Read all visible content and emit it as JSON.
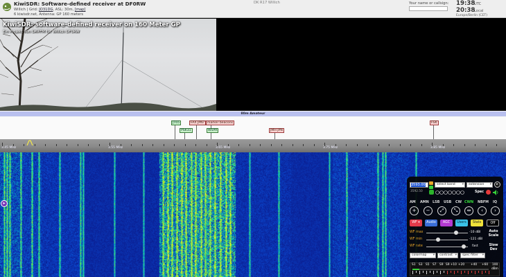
{
  "header": {
    "title": "KiwiSDR: Software-defined receiver at DF0RW",
    "subline_prefix": "Willich | Grid: ",
    "grid": "JO31DG",
    "subline_mid": ", ASL: 30m, ",
    "map_link": "[map]",
    "users_line": "6 kiwisdr.net,  Antenna: GP 160 meters",
    "center_callsign": "DK R17 Willich",
    "ident_label": "Your name or callsign:",
    "ident_value": "",
    "utc_time": "19:38",
    "utc_label": "UTC",
    "local_time": "20:38",
    "local_label": "Local",
    "timezone": "Europe/Berlin (CET)"
  },
  "photo": {
    "title": "KiwiSDR: software-defined receiver on 160 Meter GP",
    "subtitle": "Ein Projekt von DK7FM für Willich DF0RW"
  },
  "band": {
    "name": "80m Amateur"
  },
  "station_tags": [
    {
      "label": "JT65",
      "kind": "g"
    },
    {
      "label": "PSK31",
      "kind": "g"
    },
    {
      "label": "FAX JPN?",
      "kind": "r"
    },
    {
      "label": "marker beacons",
      "kind": "r"
    },
    {
      "label": "WSPR",
      "kind": "g"
    },
    {
      "label": "JMH JPN",
      "kind": "r"
    },
    {
      "label": "FSK",
      "kind": "r"
    }
  ],
  "scale": {
    "labels": [
      "3.45 MHz",
      "3.55 MHz",
      "3.65 MHz",
      "3.75 MHz",
      "3.85 MHz"
    ]
  },
  "controls": {
    "freq_value": "3593.00",
    "freq_sub": "3592.50",
    "select_band": "select band",
    "extension": "extension",
    "spec_label": "Spec",
    "modes": [
      "AM",
      "AMN",
      "LSB",
      "USB",
      "CW",
      "CWN",
      "NBFM",
      "IQ"
    ],
    "active_mode": "CWN",
    "zoom_buttons": [
      "+",
      "−",
      "⤢",
      "⤡",
      "⇔",
      "‹",
      "›"
    ],
    "buttons": {
      "wf": "WF ▾",
      "audio": "Audio",
      "agc": "AGC",
      "users": "Users",
      "stats": "Stats",
      "off": "Off"
    },
    "wf_max_label": "WF max",
    "wf_max_value": "-10 dBl",
    "wf_max_level": 0.72,
    "wf_min_label": "WF min",
    "wf_min_value": "-121 dBl",
    "wf_min_level": 0.28,
    "wf_rate_label": "WF rate",
    "wf_rate_value": "fast",
    "wf_rate_level": 0.9,
    "auto_scale_1": "Auto",
    "auto_scale_2": "Scale",
    "slow_dev_1": "Slow",
    "slow_dev_2": "Dev",
    "colormap": "colormap",
    "contrast": "contrast",
    "spec_filter": "spec filter",
    "smeter_labels": [
      "S1",
      "S3",
      "S5",
      "S7",
      "S9",
      "S9 +10",
      "+20",
      "+40",
      "+60"
    ],
    "smeter_unit_1": "100",
    "smeter_unit_2": "dBm"
  }
}
